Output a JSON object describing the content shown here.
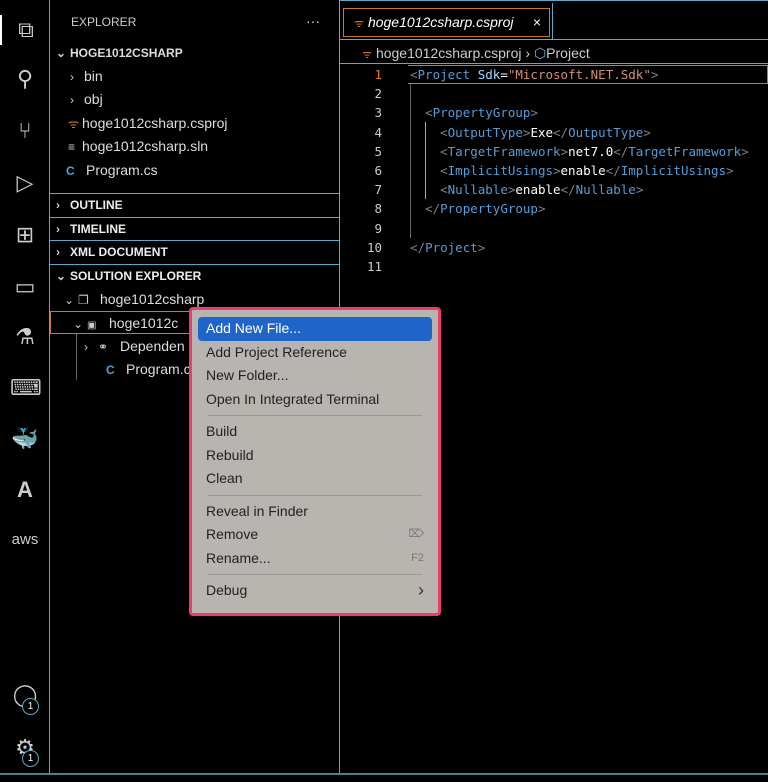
{
  "activity_bar": {
    "items": [
      "files-icon",
      "search-icon",
      "source-control-icon",
      "run-debug-icon",
      "extensions-icon",
      "remote-explorer-icon",
      "testing-icon",
      "terminal-icon",
      "docker-icon",
      "azure-icon",
      "aws-icon"
    ],
    "aws_label": "aws",
    "accounts_badge": "1",
    "settings_badge": "1"
  },
  "sidebar": {
    "title": "EXPLORER",
    "more": "···",
    "folder": "HOGE1012CSHARP",
    "files": [
      {
        "name": "bin",
        "type": "folder"
      },
      {
        "name": "obj",
        "type": "folder"
      },
      {
        "name": "hoge1012csharp.csproj",
        "type": "csproj"
      },
      {
        "name": "hoge1012csharp.sln",
        "type": "sln"
      },
      {
        "name": "Program.cs",
        "type": "cs"
      }
    ],
    "sections": [
      "OUTLINE",
      "TIMELINE",
      "XML DOCUMENT",
      "SOLUTION EXPLORER"
    ],
    "solution": {
      "solution_name": "hoge1012csharp",
      "project_name": "hoge1012c",
      "dependencies": "Dependen",
      "program": "Program.c"
    }
  },
  "editor": {
    "tab": "hoge1012csharp.csproj",
    "tab_close": "×",
    "breadcrumb": [
      "hoge1012csharp.csproj",
      "Project"
    ],
    "lines": [
      [
        [
          "p",
          "<"
        ],
        [
          "t",
          "Project"
        ],
        [
          "w",
          " "
        ],
        [
          "a",
          "Sdk"
        ],
        [
          "w",
          "="
        ],
        [
          "s",
          "\"Microsoft.NET.Sdk\""
        ],
        [
          "p",
          ">"
        ]
      ],
      [],
      [
        [
          "w",
          "  "
        ],
        [
          "p",
          "<"
        ],
        [
          "t",
          "PropertyGroup"
        ],
        [
          "p",
          ">"
        ]
      ],
      [
        [
          "w",
          "    "
        ],
        [
          "p",
          "<"
        ],
        [
          "t",
          "OutputType"
        ],
        [
          "p",
          ">"
        ],
        [
          "w",
          "Exe"
        ],
        [
          "p",
          "</"
        ],
        [
          "t",
          "OutputType"
        ],
        [
          "p",
          ">"
        ]
      ],
      [
        [
          "w",
          "    "
        ],
        [
          "p",
          "<"
        ],
        [
          "t",
          "TargetFramework"
        ],
        [
          "p",
          ">"
        ],
        [
          "w",
          "net7.0"
        ],
        [
          "p",
          "</"
        ],
        [
          "t",
          "TargetFramework"
        ],
        [
          "p",
          ">"
        ]
      ],
      [
        [
          "w",
          "    "
        ],
        [
          "p",
          "<"
        ],
        [
          "t",
          "ImplicitUsings"
        ],
        [
          "p",
          ">"
        ],
        [
          "w",
          "enable"
        ],
        [
          "p",
          "</"
        ],
        [
          "t",
          "ImplicitUsings"
        ],
        [
          "p",
          ">"
        ]
      ],
      [
        [
          "w",
          "    "
        ],
        [
          "p",
          "<"
        ],
        [
          "t",
          "Nullable"
        ],
        [
          "p",
          ">"
        ],
        [
          "w",
          "enable"
        ],
        [
          "p",
          "</"
        ],
        [
          "t",
          "Nullable"
        ],
        [
          "p",
          ">"
        ]
      ],
      [
        [
          "w",
          "  "
        ],
        [
          "p",
          "</"
        ],
        [
          "t",
          "PropertyGroup"
        ],
        [
          "p",
          ">"
        ]
      ],
      [],
      [
        [
          "p",
          "</"
        ],
        [
          "t",
          "Project"
        ],
        [
          "p",
          ">"
        ]
      ],
      []
    ]
  },
  "context_menu": {
    "groups": [
      [
        {
          "label": "Add New File...",
          "selected": true
        },
        {
          "label": "Add Project Reference"
        },
        {
          "label": "New Folder..."
        },
        {
          "label": "Open In Integrated Terminal"
        }
      ],
      [
        {
          "label": "Build"
        },
        {
          "label": "Rebuild"
        },
        {
          "label": "Clean"
        }
      ],
      [
        {
          "label": "Reveal in Finder"
        },
        {
          "label": "Remove",
          "shortcut": "⌦"
        },
        {
          "label": "Rename...",
          "shortcut": "F2"
        }
      ],
      [
        {
          "label": "Debug",
          "submenu": "›"
        }
      ]
    ]
  },
  "colors": {
    "accent": "#5fa8c8",
    "menu_border": "#ee3d6c",
    "selection": "#1f65c9",
    "active_tab_border": "#c77a2a"
  }
}
